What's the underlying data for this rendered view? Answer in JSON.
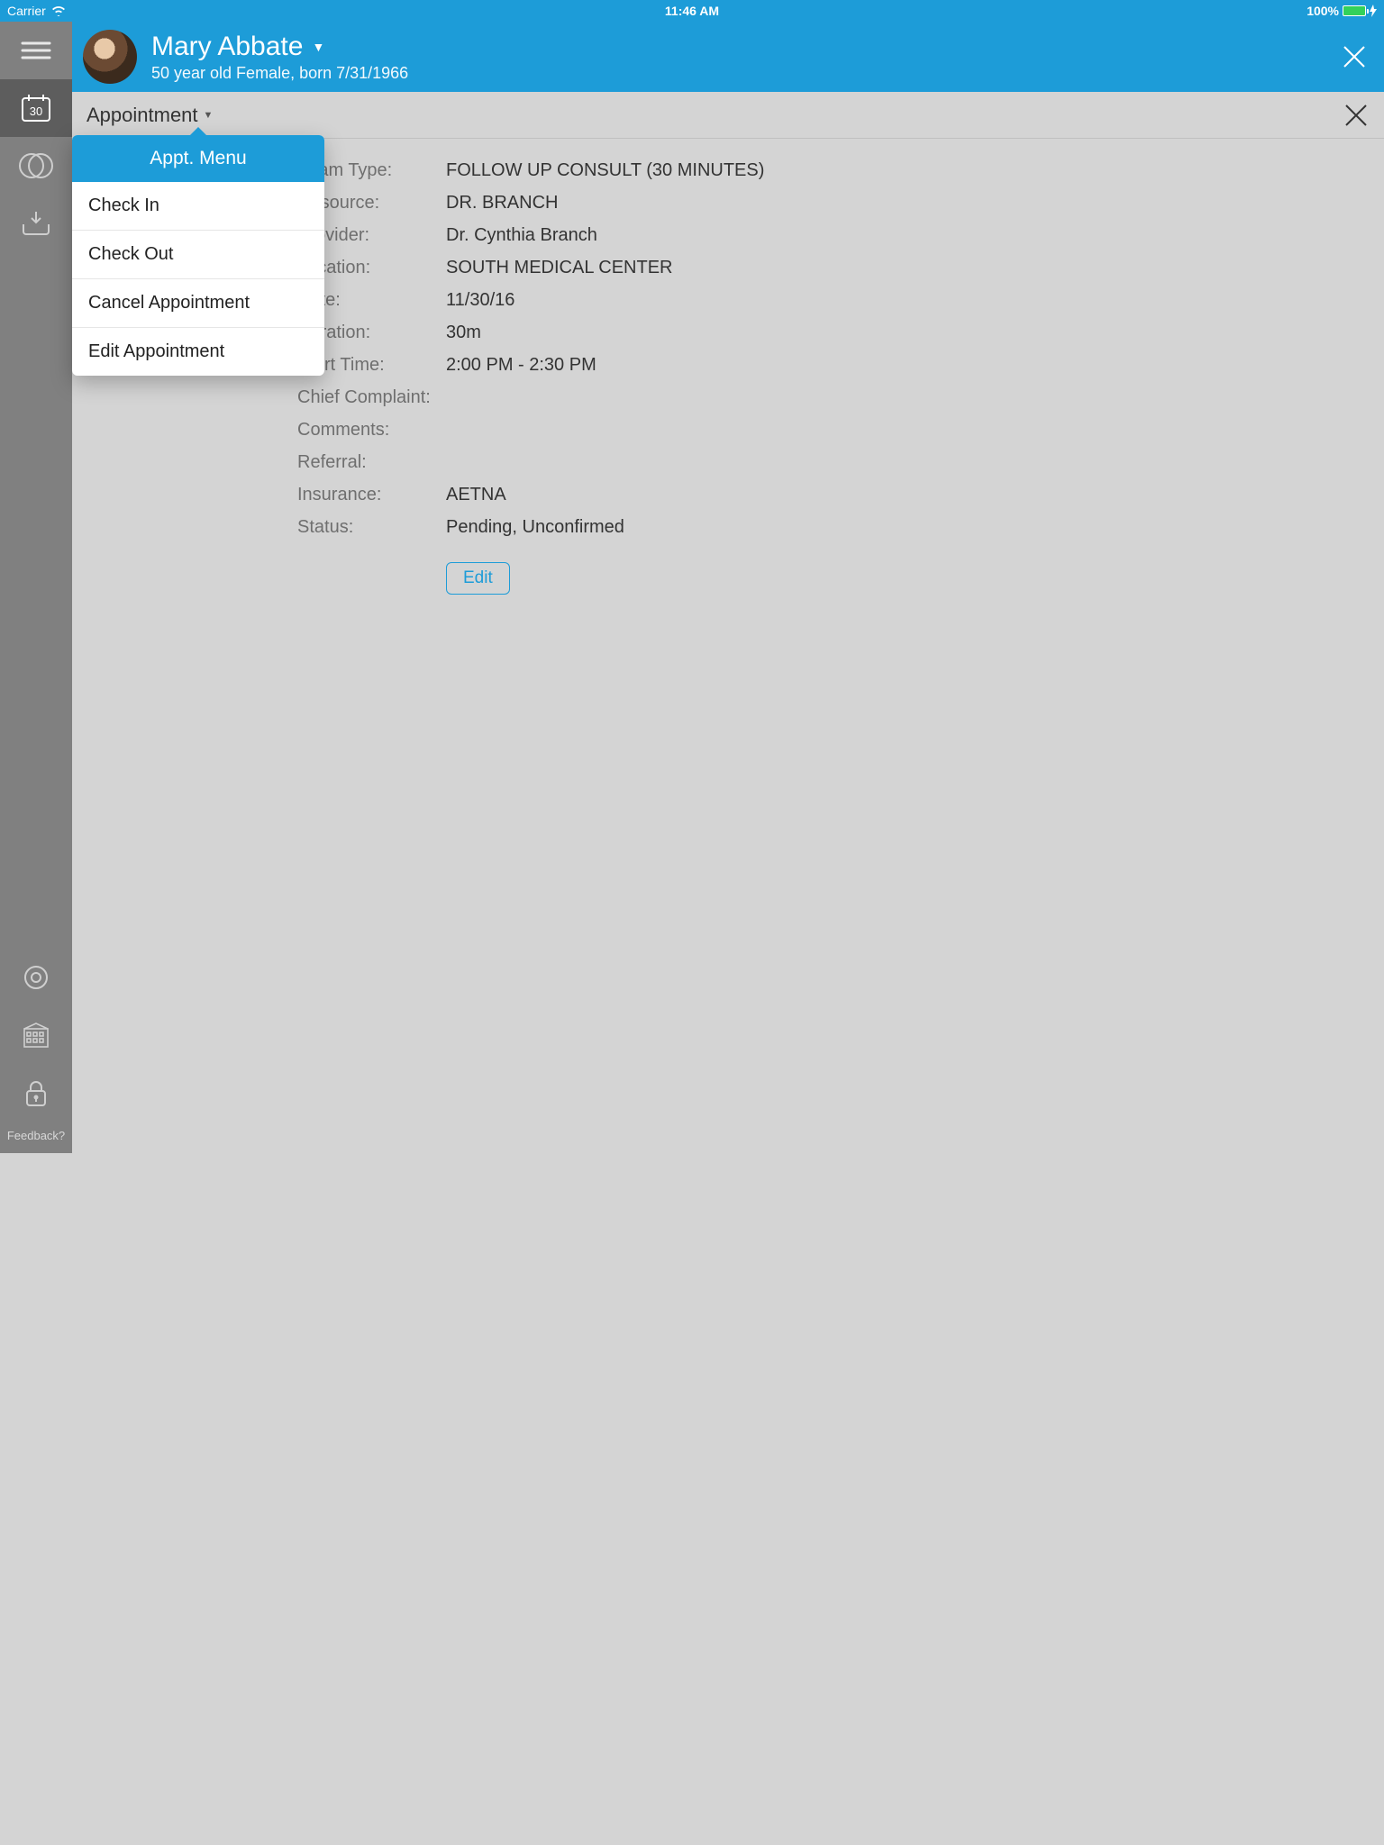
{
  "status": {
    "carrier": "Carrier",
    "time": "11:46 AM",
    "battery": "100%"
  },
  "sidebar": {
    "calendar_day": "30",
    "feedback": "Feedback?"
  },
  "header": {
    "patient_name": "Mary Abbate",
    "patient_sub": "50 year old Female, born 7/31/1966"
  },
  "subheader": {
    "title": "Appointment"
  },
  "dropdown": {
    "header": "Appt. Menu",
    "items": [
      "Check In",
      "Check Out",
      "Cancel Appointment",
      "Edit Appointment"
    ]
  },
  "details": {
    "exam_type": {
      "label": "Exam Type:",
      "value": "FOLLOW UP CONSULT (30 MINUTES)"
    },
    "resource": {
      "label": "Resource:",
      "value": "DR. BRANCH"
    },
    "provider": {
      "label": "Provider:",
      "value": "Dr. Cynthia Branch"
    },
    "location": {
      "label": "Location:",
      "value": "SOUTH MEDICAL CENTER"
    },
    "date": {
      "label": "Date:",
      "value": "11/30/16"
    },
    "duration": {
      "label": "Duration:",
      "value": "30m"
    },
    "start_time": {
      "label": "Start Time:",
      "value": "2:00 PM - 2:30 PM"
    },
    "complaint": {
      "label": "Chief Complaint:",
      "value": ""
    },
    "comments": {
      "label": "Comments:",
      "value": ""
    },
    "referral": {
      "label": "Referral:",
      "value": ""
    },
    "insurance": {
      "label": "Insurance:",
      "value": "AETNA"
    },
    "status": {
      "label": "Status:",
      "value": "Pending, Unconfirmed"
    }
  },
  "buttons": {
    "edit": "Edit"
  }
}
